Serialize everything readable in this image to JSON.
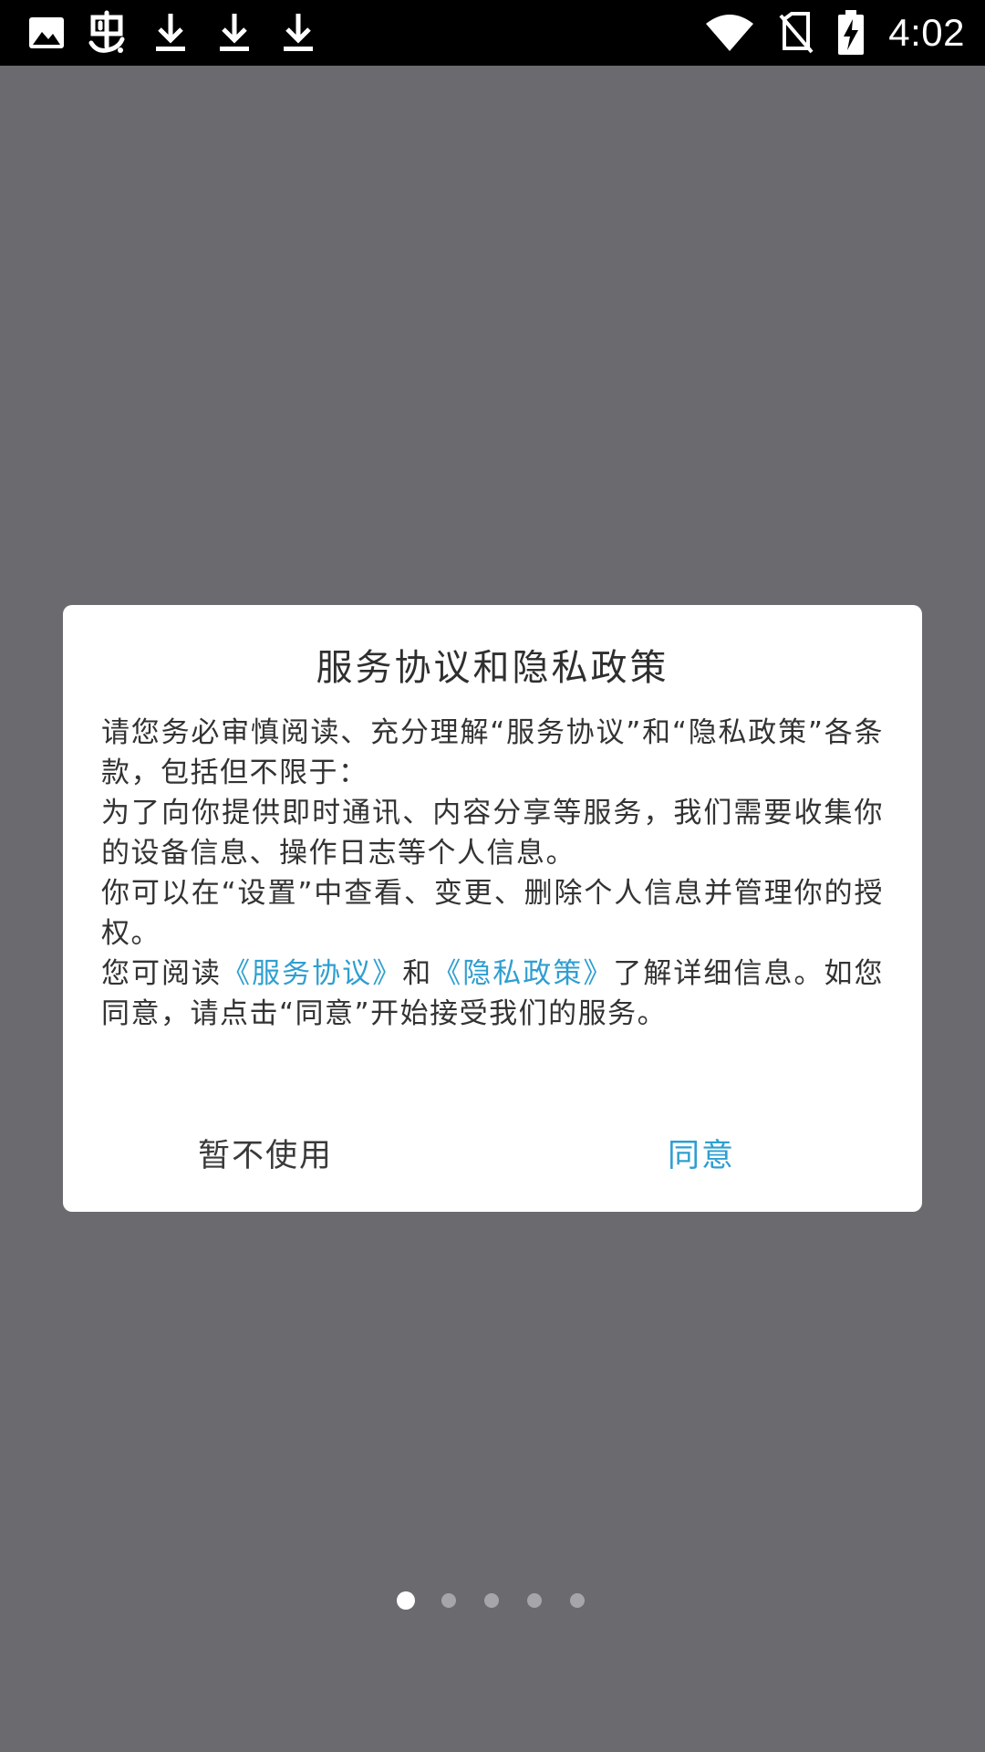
{
  "status_bar": {
    "left_icons": [
      "image-icon",
      "app-notification-icon",
      "download-icon",
      "download-icon",
      "download-icon"
    ],
    "right_icons": [
      "wifi-icon",
      "no-sim-icon",
      "battery-charging-icon"
    ],
    "time": "4:02"
  },
  "dialog": {
    "title": "服务协议和隐私政策",
    "paragraph1": "请您务必审慎阅读、充分理解“服务协议”和“隐私政策”各条款，包括但不限于：",
    "paragraph2": "为了向你提供即时通讯、内容分享等服务，我们需要收集你的设备信息、操作日志等个人信息。",
    "paragraph3": "你可以在“设置”中查看、变更、删除个人信息并管理你的授权。",
    "paragraph4_prefix": "您可阅读",
    "service_link": "《服务协议》",
    "paragraph4_and": "和",
    "privacy_link": "《隐私政策》",
    "paragraph4_suffix": "了解详细信息。如您同意，请点击“同意”开始接受我们的服务。",
    "decline_label": "暂不使用",
    "agree_label": "同意"
  },
  "pager": {
    "count": 5,
    "active_index": 0
  },
  "colors": {
    "backdrop": "#6b6a6e",
    "status_bar": "#000000",
    "link": "#2f9fd0",
    "dot_active": "#ffffff",
    "dot_inactive": "#a6a5a9"
  }
}
